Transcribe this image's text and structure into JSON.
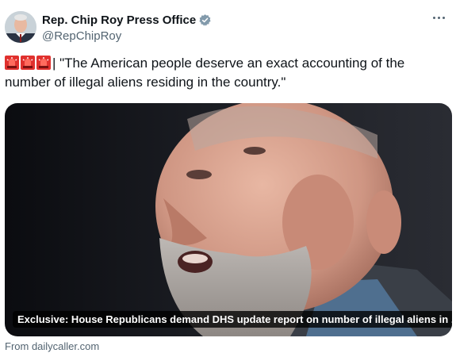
{
  "author": {
    "name": "Rep. Chip Roy Press Office",
    "handle": "@RepChipRoy",
    "verified_color": "#829aab"
  },
  "tweet": {
    "emoji_icons": [
      "police-light-icon",
      "police-light-icon",
      "police-light-icon"
    ],
    "text": "| \"The American people deserve an exact accounting of the number of illegal aliens residing in the country.\""
  },
  "link_card": {
    "headline": "Exclusive: House Republicans demand DHS update report on number of illegal aliens in ...",
    "source": "From dailycaller.com"
  },
  "colors": {
    "text_primary": "#0f1419",
    "text_secondary": "#536471",
    "siren_red": "#e0312e"
  }
}
